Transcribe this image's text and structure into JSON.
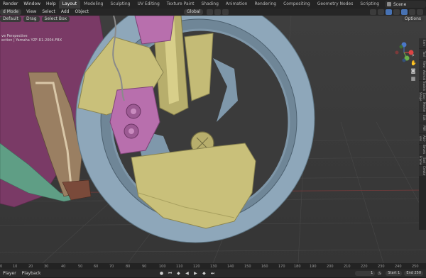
{
  "menus": [
    "Render",
    "Window",
    "Help"
  ],
  "workspaces": [
    "Layout",
    "Modeling",
    "Sculpting",
    "UV Editing",
    "Texture Paint",
    "Shading",
    "Animation",
    "Rendering",
    "Compositing",
    "Geometry Nodes",
    "Scripting"
  ],
  "add_workspace": "+",
  "scene": "Scene",
  "header": {
    "mode": "d Mode",
    "view": "View",
    "select": "Select",
    "add": "Add",
    "object": "Object",
    "transform": "Global",
    "options": "Options"
  },
  "subheader": {
    "orientation": "Default",
    "drag": "Drag",
    "select_box": "Select Box"
  },
  "viewport": {
    "overlay_line1": "ve Perspective",
    "overlay_line2": "ection | Yamaha YZF-R1-2004.FBX"
  },
  "sidebar_tabs": [
    "Item",
    "Tool",
    "View",
    "Animation",
    "Tracking",
    "Easy Shape",
    "Meshes",
    "Edit",
    "PBR",
    "Add-ons",
    "Bevels",
    "Sort Frame",
    "Create"
  ],
  "gizmo": {
    "x": "X",
    "y": "Y",
    "z": "Z"
  },
  "timeline": {
    "editor": "Player",
    "playback": "Playback",
    "current_frame": "1",
    "start_label": "Start",
    "start": "1",
    "end_label": "End",
    "end": "250",
    "ticks": [
      "10",
      "20",
      "30",
      "40",
      "50",
      "60",
      "70",
      "80",
      "90",
      "100",
      "110",
      "120",
      "130",
      "140",
      "150",
      "160",
      "170",
      "180",
      "190",
      "200",
      "210",
      "220",
      "230",
      "240",
      "250"
    ]
  },
  "colors": {
    "tire": "#8ea7ba",
    "fork": "#c9c07a",
    "caliper": "#b86fad",
    "fairing": "#7a3a66",
    "teal": "#5f9e85",
    "accent": "#4772b3"
  }
}
